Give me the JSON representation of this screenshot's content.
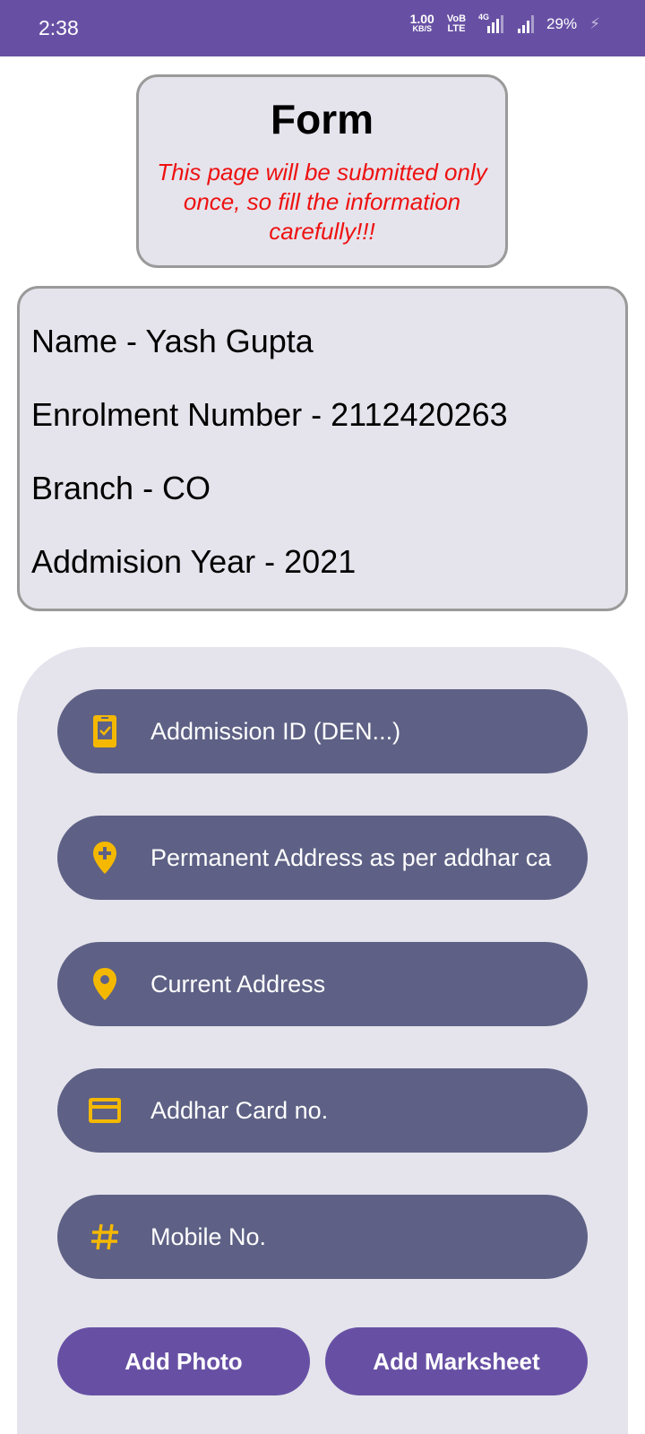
{
  "status_bar": {
    "time": "2:38",
    "net_speed_value": "1.00",
    "net_speed_unit": "KB/S",
    "volte_top": "VoB",
    "volte_bottom": "LTE",
    "network_type": "4G",
    "battery": "29%",
    "background_color": "#6750a4"
  },
  "form_header": {
    "title": "Form",
    "warning": "This page will be submitted only once, so fill the information carefully!!!",
    "warning_color": "#ee1111"
  },
  "student_info": {
    "name": "Name - Yash Gupta",
    "enrolment": "Enrolment Number - 2112420263",
    "branch": "Branch - CO",
    "admission_year": "Addmision Year - 2021"
  },
  "fields": [
    {
      "placeholder": "Addmission ID (DEN...)",
      "icon": "id-card-check-icon"
    },
    {
      "placeholder": "Permanent Address as per addhar ca",
      "icon": "location-plus-icon"
    },
    {
      "placeholder": "Current Address",
      "icon": "location-pin-icon"
    },
    {
      "placeholder": "Addhar Card no.",
      "icon": "credit-card-icon"
    },
    {
      "placeholder": "Mobile No.",
      "icon": "hash-icon"
    }
  ],
  "buttons": {
    "add_photo": "Add Photo",
    "add_marksheet": "Add Marksheet"
  },
  "colors": {
    "field_background": "#5e6185",
    "icon_accent": "#f5b800",
    "button_background": "#6750a4",
    "panel_background": "#e5e4ec"
  }
}
